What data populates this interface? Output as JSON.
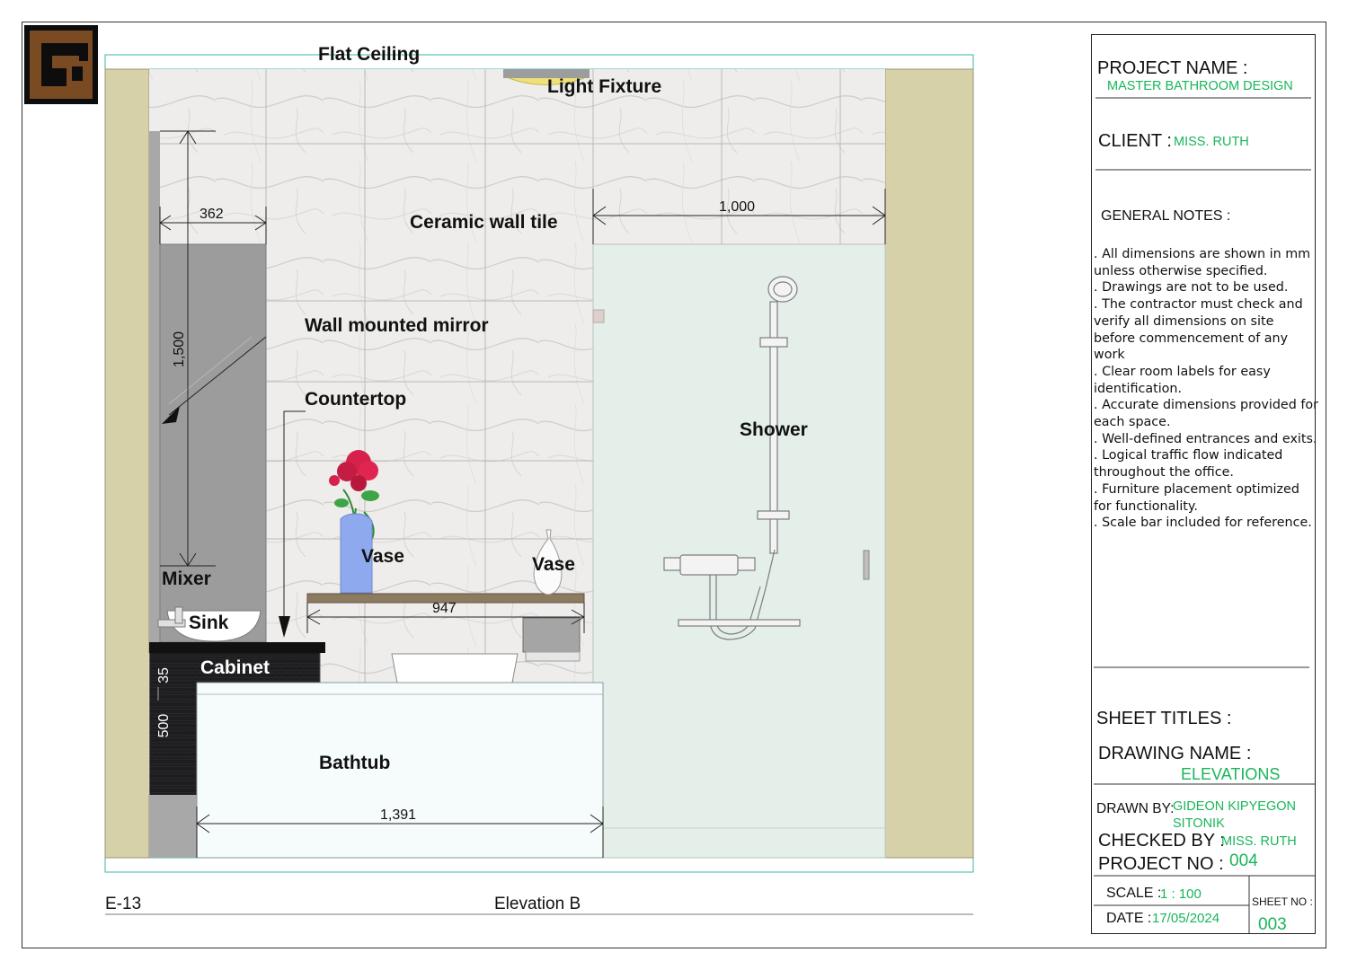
{
  "labels": {
    "flat_ceiling": "Flat Ceiling",
    "light_fixture": "Light Fixture",
    "ceramic_wall_tile": "Ceramic wall tile",
    "wall_mounted_mirror": "Wall mounted mirror",
    "countertop": "Countertop",
    "shower": "Shower",
    "vase_left": "Vase",
    "vase_right": "Vase",
    "mixer": "Mixer",
    "sink": "Sink",
    "cabinet": "Cabinet",
    "bathtub": "Bathtub"
  },
  "dimensions": {
    "mirror_width": "362",
    "shower_width": "1,000",
    "mirror_height": "1,500",
    "countertop_width": "947",
    "countertop_thickness": "35",
    "cabinet_height": "500",
    "bathtub_width": "1,391"
  },
  "footer": {
    "sheet_code": "E-13",
    "view_title": "Elevation B"
  },
  "title_block": {
    "project_name_label": "PROJECT NAME :",
    "project_name": "MASTER BATHROOM DESIGN",
    "client_label": "CLIENT :",
    "client": "MISS. RUTH",
    "general_notes_label": "GENERAL NOTES :",
    "notes": [
      ". All dimensions are shown in mm unless otherwise specified.",
      ". Drawings are not to be used.",
      ". The contractor must check and verify all dimensions on site before commencement of any work",
      ". Clear room labels for easy identification.",
      ". Accurate dimensions provided for each space.",
      ". Well-defined entrances and exits.",
      ". Logical traffic flow indicated throughout the office.",
      ". Furniture placement optimized for functionality.",
      ". Scale bar included for reference."
    ],
    "sheet_titles_label": "SHEET  TITLES :",
    "drawing_name_label": "DRAWING NAME :",
    "drawing_name": "ELEVATIONS",
    "drawn_by_label": "DRAWN BY:",
    "drawn_by_line1": "GIDEON KIPYEGON",
    "drawn_by_line2": "SITONIK",
    "checked_by_label": "CHECKED BY :",
    "checked_by": "MISS. RUTH",
    "project_no_label": "PROJECT NO :",
    "project_no": "004",
    "scale_label": "SCALE :",
    "scale": "1 : 100",
    "date_label": "DATE  :",
    "date": "17/05/2024",
    "sheet_no_label": "SHEET NO :",
    "sheet_no": "003"
  },
  "colors": {
    "side_wall": "#d7d1a9",
    "tile_wall": "#ecebea",
    "shower_glass": "#e4efe9",
    "cabinet": "#1d1d1f",
    "mirror": "#9c9c9c",
    "vase": "#8fa9ef",
    "rose": "#d6224a",
    "annotation_green": "#19b55a",
    "logo_brown": "#7a4a22"
  }
}
